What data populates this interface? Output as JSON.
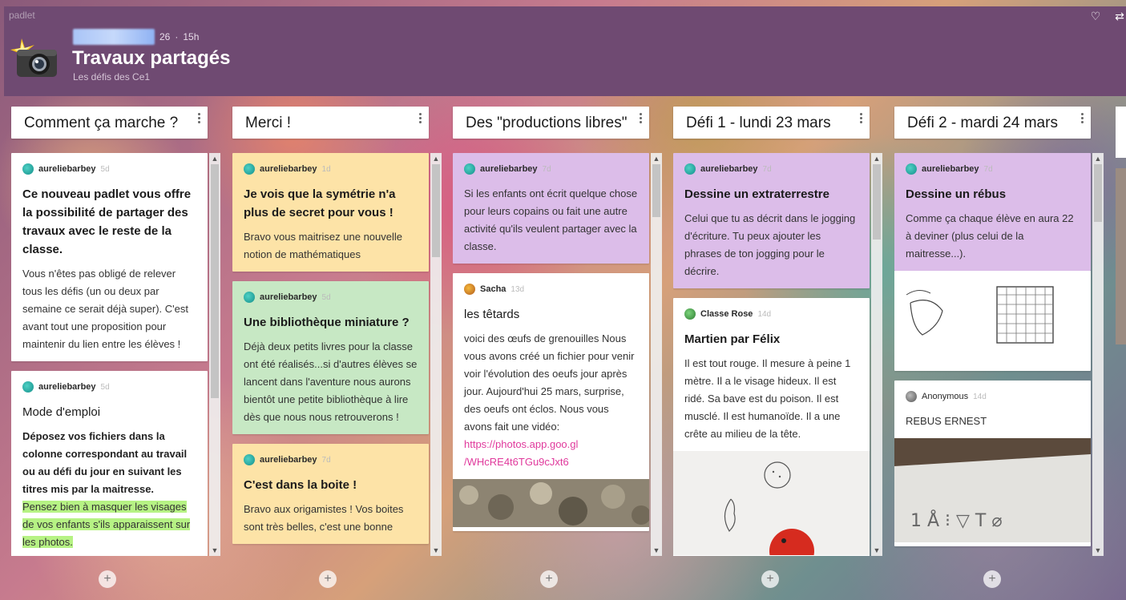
{
  "app": {
    "brand": "padlet"
  },
  "header": {
    "meta_count": "26",
    "meta_sep": "·",
    "meta_time": "15h",
    "title": "Travaux partagés",
    "subtitle": "Les défis des Ce1"
  },
  "columns": [
    {
      "title": "Comment ça marche ?",
      "cards": [
        {
          "author": "aureliebarbey",
          "age": "5d",
          "title": "Ce nouveau padlet vous offre la possibilité de partager des travaux avec le reste de la classe.",
          "text": "Vous n'êtes pas obligé de relever tous les défis (un ou deux par semaine ce serait déjà super). C'est avant tout une proposition pour maintenir du lien entre les élèves !"
        },
        {
          "author": "aureliebarbey",
          "age": "5d",
          "title": "Mode d'emploi",
          "text_bold": "Déposez vos fichiers dans la colonne correspondant au travail ou au défi du jour en suivant les titres mis par la maitresse.",
          "text_highlight": "Pensez bien à masquer les visages de vos enfants s'ils apparaissent sur les photos."
        }
      ]
    },
    {
      "title": "Merci !",
      "cards": [
        {
          "author": "aureliebarbey",
          "age": "1d",
          "title": "Je vois que la symétrie n'a plus de secret pour vous !",
          "text": "Bravo vous maitrisez une nouvelle notion de mathématiques"
        },
        {
          "author": "aureliebarbey",
          "age": "5d",
          "title": "Une bibliothèque miniature ?",
          "text": "Déjà deux petits livres pour la classe ont été réalisés...si d'autres élèves se lancent dans l'aventure nous aurons bientôt une petite bibliothèque à lire dès que nous nous retrouverons !"
        },
        {
          "author": "aureliebarbey",
          "age": "7d",
          "title": "C'est dans la boite !",
          "text": "Bravo aux origamistes ! Vos boites sont très belles, c'est une bonne"
        }
      ]
    },
    {
      "title": "Des \"productions libres\"",
      "cards": [
        {
          "author": "aureliebarbey",
          "age": "7d",
          "text": "Si les enfants ont écrit quelque chose pour leurs copains ou fait une autre activité qu'ils veulent partager avec la classe."
        },
        {
          "author": "Sacha",
          "age": "13d",
          "title": "les têtards",
          "text": "voici des œufs de grenouilles Nous vous avons créé un fichier pour venir voir l'évolution des oeufs jour après jour. Aujourd'hui 25 mars, surprise, des oeufs ont éclos. Nous vous avons fait une vidéo:",
          "link": "https://photos.app.goo.gl /WHcRE4t6TGu9cJxt6"
        }
      ]
    },
    {
      "title": "Défi 1 - lundi 23 mars",
      "cards": [
        {
          "author": "aureliebarbey",
          "age": "7d",
          "title": "Dessine un extraterrestre",
          "text": "Celui que tu as décrit dans le jogging d'écriture. Tu peux ajouter les phrases de ton jogging pour le décrire."
        },
        {
          "author": "Classe Rose",
          "age": "14d",
          "title": "Martien par Félix",
          "text": "Il est tout rouge. Il mesure à peine 1 mètre. Il a le visage hideux. Il est ridé. Sa bave est du poison. Il est musclé. Il est humanoïde. Il a une crête au milieu de la tête."
        }
      ]
    },
    {
      "title": "Défi 2 - mardi 24 mars",
      "cards": [
        {
          "author": "aureliebarbey",
          "age": "7d",
          "title": "Dessine un rébus",
          "text": "Comme ça chaque élève en aura 22 à deviner (plus celui de la maitresse...)."
        },
        {
          "author": "Anonymous",
          "age": "14d",
          "text": "REBUS ERNEST"
        }
      ]
    }
  ],
  "add_post": "+"
}
